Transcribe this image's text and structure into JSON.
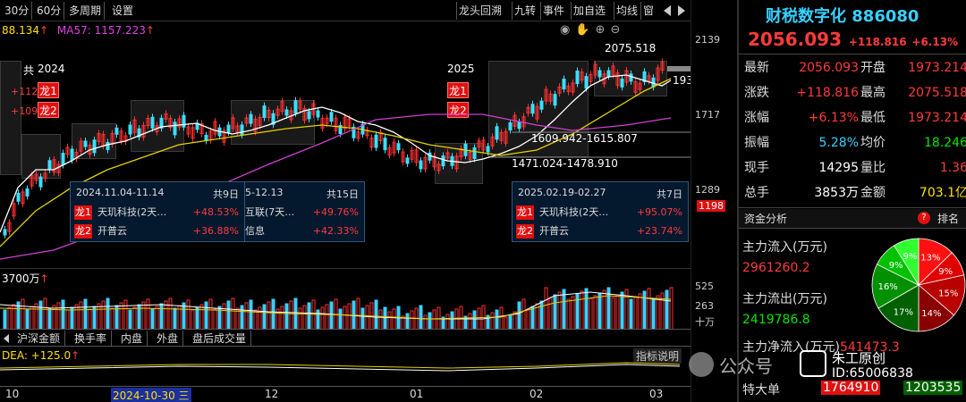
{
  "toolbar_left": [
    "30分",
    "60分",
    "多周期",
    "设置"
  ],
  "toolbar_right": [
    "龙头回溯",
    "九转",
    "事件",
    "加自选",
    "均线",
    "窗"
  ],
  "ma_line": {
    "ma1": "88.134",
    "ma1_arrow": "↑",
    "ma2_label": "MA57:",
    "ma2": "1157.223",
    "ma2_arrow": "↑"
  },
  "price_labels": {
    "high_mark": "2075.518",
    "low_range1": "1609.942-1615.807",
    "low_range2": "1471.024-1478.910",
    "partial_right": "193"
  },
  "year_tags": {
    "y2024": "2024",
    "y2025": "2025",
    "partial_left": "共"
  },
  "leader_tags": {
    "l1": "龙1",
    "l2": "龙2"
  },
  "left_partial_values": {
    "v1": "+112",
    "v2": "+109"
  },
  "popups": [
    {
      "period": "2024.11.04-11.14",
      "days": "共9日",
      "rows": [
        {
          "tag": "龙1",
          "name": "天玑科技(2天…",
          "pct": "+48.53%"
        },
        {
          "tag": "龙2",
          "name": "开普云",
          "pct": "+36.88%"
        }
      ]
    },
    {
      "period": "5-12.13",
      "days": "共15日",
      "rows": [
        {
          "name": "互联(7天…",
          "pct": "+49.76%"
        },
        {
          "name": "信息",
          "pct": "+42.33%"
        }
      ]
    },
    {
      "period": "2025.02.19-02.27",
      "days": "共7日",
      "rows": [
        {
          "tag": "龙1",
          "name": "天玑科技(2天…",
          "pct": "+95.07%"
        },
        {
          "tag": "龙2",
          "name": "开普云",
          "pct": "+23.74%"
        }
      ]
    }
  ],
  "volume_label": "3700万",
  "volume_arrow": "↑",
  "bottom_tabs": [
    "沪深金额",
    "换手率",
    "内盘",
    "外盘",
    "盘后成交量"
  ],
  "dea_label": "DEA: +125.0",
  "dea_arrow": "↑",
  "indicator_btn": "指标说明",
  "x_labels": [
    "10",
    "2024-10-30 三",
    "12",
    "01",
    "02",
    "03"
  ],
  "price_axis": [
    "2139",
    "1717",
    "1289",
    "1198"
  ],
  "volume_axis": [
    "525",
    "263",
    "十万"
  ],
  "stock": {
    "name": "财税数字化",
    "code": "886080",
    "price": "2056.093",
    "change": "+118.816",
    "pct": "+6.13%"
  },
  "quote": [
    {
      "l1": "最新",
      "v1": "2056.093",
      "l2": "开盘",
      "v2": "1973.214"
    },
    {
      "l1": "涨跌",
      "v1": "+118.816",
      "l2": "最高",
      "v2": "2075.518"
    },
    {
      "l1": "涨幅",
      "v1": "+6.13%",
      "l2": "最低",
      "v2": "1973.214"
    },
    {
      "l1": "振幅",
      "v1": "5.28%",
      "l2": "均价",
      "v2": "18.246"
    },
    {
      "l1": "现手",
      "v1": "14295",
      "l2": "量比",
      "v2": "1.36"
    },
    {
      "l1": "总手",
      "v1": "3853万",
      "l2": "金额",
      "v2": "703.1亿"
    }
  ],
  "fund": {
    "title": "资金分析",
    "rank": "排名",
    "inflow_label": "主力流入(万元)",
    "inflow": "2961260.2",
    "outflow_label": "主力流出(万元)",
    "outflow": "2419786.8",
    "net_label": "主力净流入(万元)",
    "net": "541473.3",
    "big_label": "特大单",
    "big_in": "1764910",
    "big_out": "1203535"
  },
  "pie": [
    {
      "label": "13%",
      "value": 13,
      "color": "#ff1010"
    },
    {
      "label": "9%",
      "value": 9,
      "color": "#e00000"
    },
    {
      "label": "15%",
      "value": 15,
      "color": "#b80000"
    },
    {
      "label": "14%",
      "value": 14,
      "color": "#8a0000"
    },
    {
      "label": "17%",
      "value": 17,
      "color": "#006000"
    },
    {
      "label": "16%",
      "value": 16,
      "color": "#009000"
    },
    {
      "label": "9%",
      "value": 9,
      "color": "#00c000"
    },
    {
      "label": "9%",
      "value": 9,
      "color": "#30ff30"
    }
  ],
  "watermark": {
    "text": "公众号",
    "author": "朱工原创",
    "id": "ID:65006838"
  }
}
